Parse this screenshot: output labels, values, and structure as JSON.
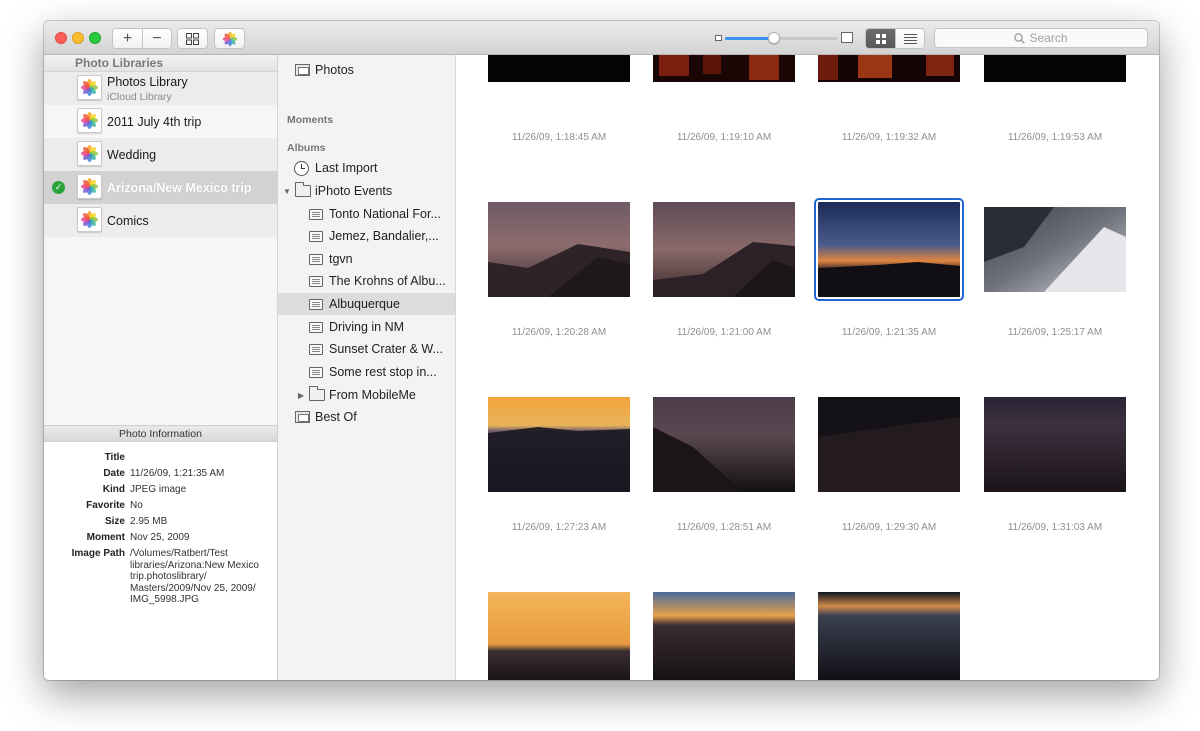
{
  "toolbar": {
    "add_label": "+",
    "remove_label": "−",
    "search_placeholder": "Search",
    "zoom_level": 0.43
  },
  "sidebar": {
    "header": "Photo Libraries",
    "libraries": [
      {
        "name": "Photos Library",
        "subtitle": "iCloud Library"
      },
      {
        "name": "2011 July 4th trip"
      },
      {
        "name": "Wedding"
      },
      {
        "name": "Arizona/New Mexico trip",
        "selected": true
      },
      {
        "name": "Comics"
      }
    ]
  },
  "info": {
    "header": "Photo Information",
    "fields": [
      {
        "key": "Title",
        "value": ""
      },
      {
        "key": "Date",
        "value": "11/26/09, 1:21:35 AM"
      },
      {
        "key": "Kind",
        "value": "JPEG image"
      },
      {
        "key": "Favorite",
        "value": "No"
      },
      {
        "key": "Size",
        "value": "2.95 MB"
      },
      {
        "key": "Moment",
        "value": "Nov 25, 2009"
      },
      {
        "key": "Image Path",
        "value": "/Volumes/Ratbert/Test libraries/Arizona:New Mexico trip.photoslibrary/ Masters/2009/Nov 25, 2009/ IMG_5998.JPG"
      }
    ]
  },
  "albums": {
    "photos": "Photos",
    "moments_header": "Moments",
    "albums_header": "Albums",
    "last_import": "Last Import",
    "iphoto_events": "iPhoto Events",
    "events": [
      "Tonto National For...",
      "Jemez, Bandalier,...",
      "tgvn",
      "The Krohns of Albu...",
      "Albuquerque",
      "Driving in NM",
      "Sunset Crater & W...",
      "Some rest stop in..."
    ],
    "selected_event": "Albuquerque",
    "from_mobileme": "From MobileMe",
    "best_of": "Best Of"
  },
  "photos": [
    {
      "time": "11/26/09, 1:18:45 AM"
    },
    {
      "time": "11/26/09, 1:19:10 AM"
    },
    {
      "time": "11/26/09, 1:19:32 AM"
    },
    {
      "time": "11/26/09, 1:19:53 AM"
    },
    {
      "time": "11/26/09, 1:20:28 AM"
    },
    {
      "time": "11/26/09, 1:21:00 AM"
    },
    {
      "time": "11/26/09, 1:21:35 AM",
      "selected": true
    },
    {
      "time": "11/26/09, 1:25:17 AM"
    },
    {
      "time": "11/26/09, 1:27:23 AM"
    },
    {
      "time": "11/26/09, 1:28:51 AM"
    },
    {
      "time": "11/26/09, 1:29:30 AM"
    },
    {
      "time": "11/26/09, 1:31:03 AM"
    },
    {
      "time": ""
    },
    {
      "time": ""
    },
    {
      "time": ""
    }
  ],
  "colors": {
    "accent": "#2465d6",
    "slider_fill": "#3b8ff6",
    "selected_check": "#2aa33b"
  }
}
